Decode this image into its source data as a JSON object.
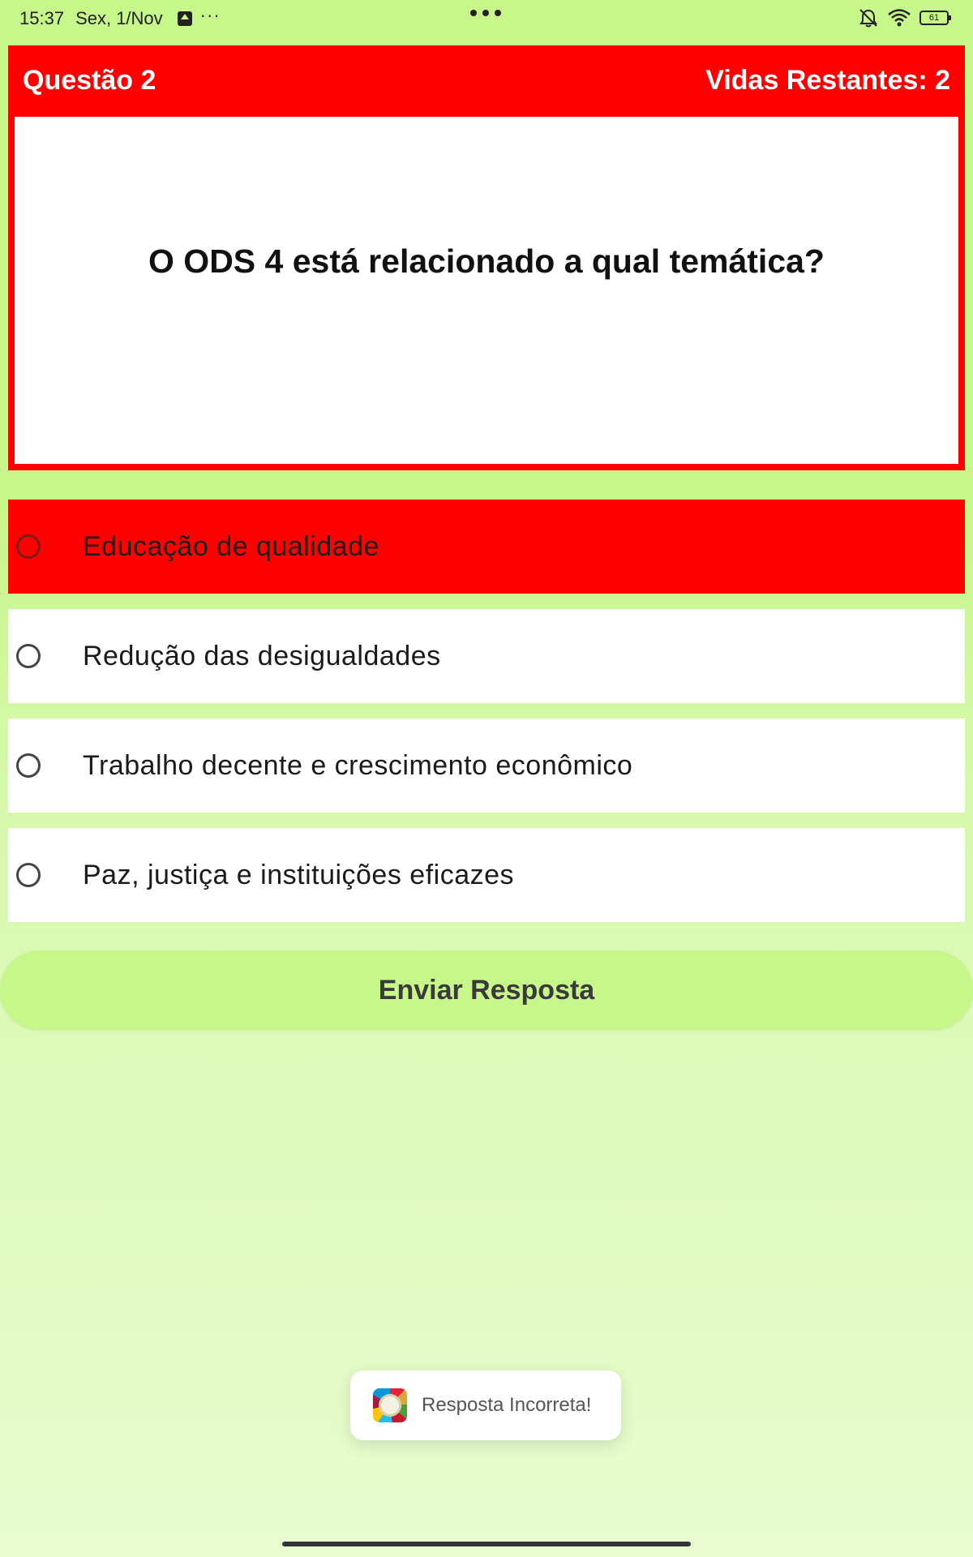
{
  "status_bar": {
    "time": "15:37",
    "date": "Sex, 1/Nov",
    "overflow_dots": "···",
    "battery_level": "61",
    "icons": [
      "upload-icon",
      "more-dots-icon",
      "bell-muted-icon",
      "wifi-icon",
      "battery-icon"
    ]
  },
  "header": {
    "question_number": "Questão 2",
    "lives": "Vidas Restantes: 2"
  },
  "question": {
    "text": "O ODS 4 está relacionado a qual temática?"
  },
  "options": [
    {
      "label": "Educação de qualidade",
      "selected": true
    },
    {
      "label": "Redução das desigualdades",
      "selected": false
    },
    {
      "label": "Trabalho decente e crescimento econômico",
      "selected": false
    },
    {
      "label": "Paz, justiça e instituições eficazes",
      "selected": false
    }
  ],
  "submit": {
    "label": "Enviar Resposta"
  },
  "toast": {
    "text": "Resposta Incorreta!"
  },
  "colors": {
    "accent_red": "#ff0000",
    "background_green": "#c7f68a",
    "button_green": "#c7f68a"
  }
}
